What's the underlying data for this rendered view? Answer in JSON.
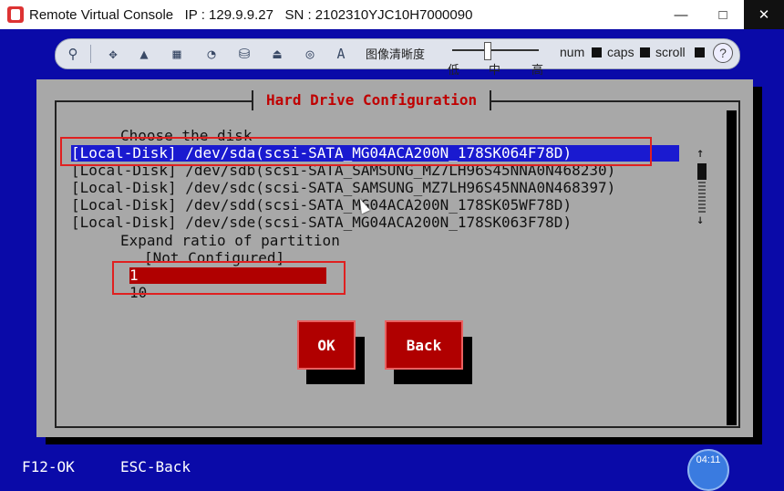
{
  "window": {
    "title": "Remote Virtual Console   IP : 129.9.9.27   SN : 2102310YJC10H7000090",
    "minimize": "—",
    "maximize": "□",
    "close": "✕"
  },
  "toolbar": {
    "icons": [
      "connect-icon",
      "move-icon",
      "arrow-icon",
      "keyboard-icon",
      "mouse-icon",
      "floppy-icon",
      "cd-drive-icon",
      "disc-icon",
      "font-icon"
    ],
    "image_quality_label": "图像清晰度",
    "quality_low": "低",
    "quality_mid": "中",
    "quality_high": "高",
    "num_label": "num",
    "caps_label": "caps",
    "scroll_label": "scroll",
    "help_symbol": "?"
  },
  "dialog": {
    "title": "Hard Drive Configuration",
    "choose_disk_label": "Choose the disk",
    "disks": [
      "[Local-Disk] /dev/sda(scsi-SATA_MG04ACA200N_178SK064F78D)",
      "[Local-Disk] /dev/sdb(scsi-SATA_SAMSUNG_MZ7LH96S45NNA0N468230)",
      "[Local-Disk] /dev/sdc(scsi-SATA_SAMSUNG_MZ7LH96S45NNA0N468397)",
      "[Local-Disk] /dev/sdd(scsi-SATA_MG04ACA200N_178SK05WF78D)",
      "[Local-Disk] /dev/sde(scsi-SATA_MG04ACA200N_178SK063F78D)"
    ],
    "selected_disk_index": 0,
    "expand_ratio_label": "Expand ratio of partition",
    "ratio_options": [
      "[Not Configured]",
      "1",
      "10"
    ],
    "selected_ratio_index": 1,
    "scroll_up": "↑",
    "scroll_down": "↓",
    "ok_button": "OK",
    "back_button": "Back"
  },
  "status_bar": {
    "f12": "F12-OK",
    "esc": "ESC-Back"
  },
  "clock": "04:11",
  "colors": {
    "background": "#0a0aa8",
    "dialog": "#a8a8a8",
    "title_red": "#c00000",
    "selection_blue": "#1a1ad0",
    "button_red": "#b00000",
    "annotation_red": "#e02020"
  }
}
